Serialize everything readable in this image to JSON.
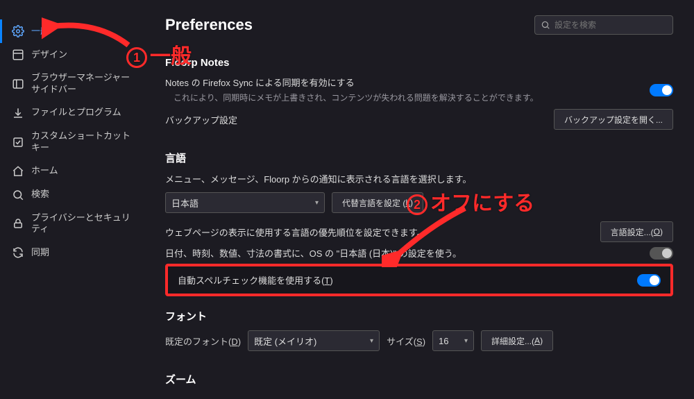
{
  "sidebar": {
    "items": [
      {
        "label": "一般"
      },
      {
        "label": "デザイン"
      },
      {
        "label": "ブラウザーマネージャーサイドバー"
      },
      {
        "label": "ファイルとプログラム"
      },
      {
        "label": "カスタムショートカットキー"
      },
      {
        "label": "ホーム"
      },
      {
        "label": "検索"
      },
      {
        "label": "プライバシーとセキュリティ"
      },
      {
        "label": "同期"
      }
    ]
  },
  "header": {
    "title": "Preferences",
    "search_placeholder": "設定を検索"
  },
  "notes": {
    "section_title": "Floorp Notes",
    "sync_label": "Notes の Firefox Sync による同期を有効にする",
    "sync_desc": "これにより、同期時にメモが上書きされ、コンテンツが失われる問題を解決することができます。",
    "backup_label": "バックアップ設定",
    "backup_button": "バックアップ設定を開く..."
  },
  "language": {
    "section_title": "言語",
    "desc1": "メニュー、メッセージ、Floorp からの通知に表示される言語を選択します。",
    "current": "日本語",
    "alt_button_pre": "代替言語を設定 (",
    "alt_button_key": "L",
    "alt_button_post": ")",
    "desc2": "ウェブページの表示に使用する言語の優先順位を設定できます。",
    "lang_button_pre": "言語設定...(",
    "lang_button_key": "O",
    "lang_button_post": ")",
    "os_format_label": "日付、時刻、数値、寸法の書式に、OS の \"日本語 (日本)\" の設定を使う。",
    "spellcheck_pre": "自動スペルチェック機能を使用する(",
    "spellcheck_key": "T",
    "spellcheck_post": ")"
  },
  "font": {
    "section_title": "フォント",
    "default_label_pre": "既定のフォント(",
    "default_label_key": "D",
    "default_label_post": ")",
    "default_value": "既定 (メイリオ)",
    "size_label_pre": "サイズ(",
    "size_label_key": "S",
    "size_label_post": ")",
    "size_value": "16",
    "adv_button_pre": "詳細設定...(",
    "adv_button_key": "A",
    "adv_button_post": ")"
  },
  "zoom": {
    "section_title": "ズーム"
  },
  "annotations": {
    "a1_num": "1",
    "a1_text": "一般",
    "a2_num": "2",
    "a2_text": "オフにする"
  }
}
